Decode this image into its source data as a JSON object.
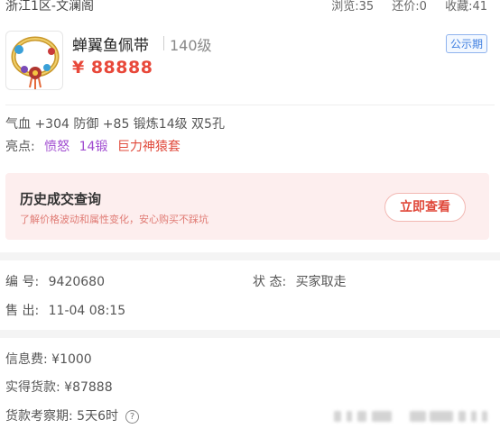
{
  "topbar": {
    "server": "浙江1区-文澜阁",
    "views": "浏览:35",
    "bargain": "还价:0",
    "favorites": "收藏:41"
  },
  "item": {
    "name": "蝉翼鱼佩带",
    "level": "140级",
    "price": "¥ 88888",
    "badge": "公示期",
    "icon": "jade-belt-pendant-image"
  },
  "attributes": "气血 +304 防御 +85 锻炼14级 双5孔",
  "highlights": {
    "label": "亮点:",
    "tags": [
      "愤怒",
      "14锻",
      "巨力神猿套"
    ]
  },
  "history": {
    "title": "历史成交查询",
    "subtitle": "了解价格波动和属性变化，安心购买不踩坑",
    "button": "立即查看"
  },
  "order": {
    "id_label": "编 号:",
    "id_value": "9420680",
    "status_label": "状 态:",
    "status_value": "买家取走",
    "sold_label": "售 出:",
    "sold_value": "11-04 08:15"
  },
  "fees": {
    "info_fee": "信息费: ¥1000",
    "received": "实得货款: ¥87888",
    "review_period": "货款考察期: 5天6时",
    "help_icon": "question-circle-icon"
  },
  "colors": {
    "price": "#e8483a",
    "highlight_purple": "#a04bd0",
    "highlight_red": "#e0483a",
    "badge_blue": "#3f7fe0",
    "history_bg": "#fdeeee"
  }
}
